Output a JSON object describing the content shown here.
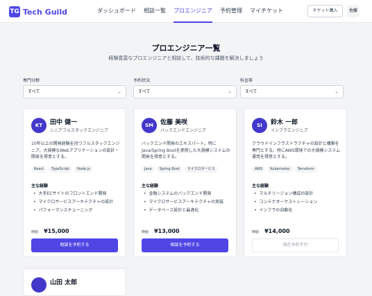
{
  "header": {
    "logo_mark": "TG",
    "logo_text": "Tech Guild",
    "nav": [
      "ダッシュボード",
      "相談一覧",
      "プロエンジニア",
      "予約管理",
      "マイチケット"
    ],
    "active_index": 2,
    "ticket_button": "チケット購入",
    "user": "佐藤"
  },
  "page": {
    "title": "プロエンジニア一覧",
    "subtitle": "経験豊富なプロエンジニアと相談して、技術的な課題を解決しましょう"
  },
  "filters": [
    {
      "label": "専門分野",
      "value": "すべて"
    },
    {
      "label": "予約状況",
      "value": "すべて"
    },
    {
      "label": "料金帯",
      "value": "すべて"
    }
  ],
  "engineers": [
    {
      "initials": "KT",
      "name": "田中 健一",
      "role": "シニアフルスタックエンジニア",
      "description": "10年以上の開発経験を持つフルスタックエンジニア。大規模なWebアプリケーションの設計・開発を得意とする。",
      "tags": [
        "React",
        "TypeScript",
        "Node.js"
      ],
      "experience_title": "主な経験",
      "experience": [
        "大手ECサイトのフロントエンド開発",
        "マイクロサービスアーキテクチャの設計",
        "パフォーマンスチューニング"
      ],
      "price_label": "時給",
      "price": "¥15,000",
      "button": "相談を予約する",
      "available": true
    },
    {
      "initials": "SM",
      "name": "佐藤 美咲",
      "role": "バックエンドエンジニア",
      "description": "バックエンド開発のエキスパート。特にJava/Spring Bootを使用した大規模システムの開発を得意とする。",
      "tags": [
        "Java",
        "Spring Boot",
        "マイクロサービス"
      ],
      "experience_title": "主な経験",
      "experience": [
        "金融システムのバックエンド開発",
        "マイクロサービスアーキテクチャの実装",
        "データベース設計と最適化"
      ],
      "price_label": "時給",
      "price": "¥13,000",
      "button": "相談を予約する",
      "available": true
    },
    {
      "initials": "SI",
      "name": "鈴木 一郎",
      "role": "インフラエンジニア",
      "description": "クラウドインフラストラクチャの設計と構築を専門とする。特にAWS環境での大規模システム運用を得意とする。",
      "tags": [
        "AWS",
        "Kubernetes",
        "Terraform"
      ],
      "experience_title": "主な経験",
      "experience": [
        "マルチリージョン構成の設計",
        "コンテナオーケストレーション",
        "インフラの自動化"
      ],
      "price_label": "時給",
      "price": "¥14,000",
      "button": "現在予約不可",
      "available": false
    }
  ],
  "partial_card": {
    "name": "山田 太郎"
  }
}
